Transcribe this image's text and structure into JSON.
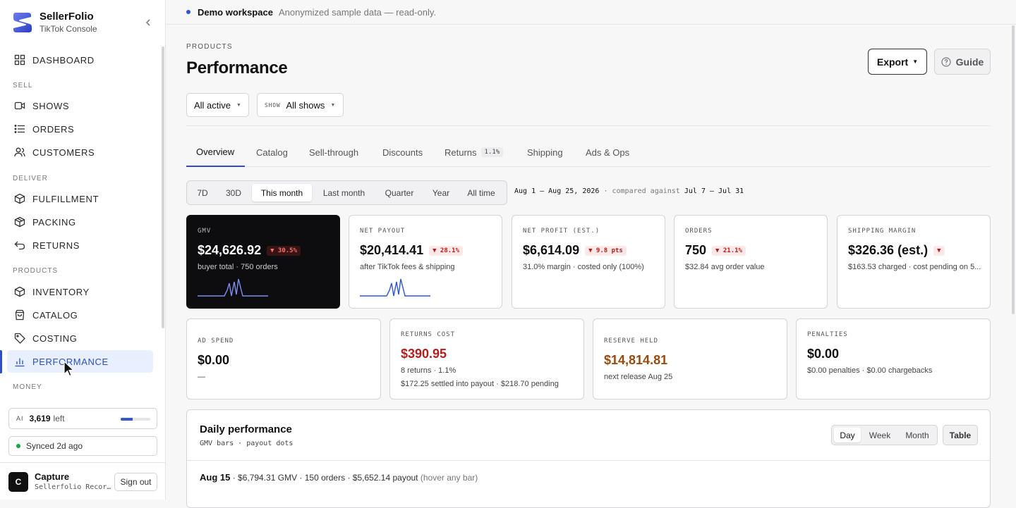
{
  "brand": {
    "name": "SellerFolio",
    "sub": "TikTok Console"
  },
  "nav": {
    "dashboard": "DASHBOARD",
    "sections": {
      "sell": "SELL",
      "deliver": "DELIVER",
      "products": "PRODUCTS",
      "money": "MONEY"
    },
    "shows": "SHOWS",
    "orders": "ORDERS",
    "customers": "CUSTOMERS",
    "fulfillment": "FULFILLMENT",
    "packing": "PACKING",
    "returns": "RETURNS",
    "inventory": "INVENTORY",
    "catalog": "CATALOG",
    "costing": "COSTING",
    "performance": "PERFORMANCE"
  },
  "ai": {
    "label": "AI",
    "count": "3,619",
    "left": "left",
    "usage_fraction": 0.4
  },
  "sync": {
    "text": "Synced 2d ago"
  },
  "user": {
    "initial": "C",
    "name": "Capture",
    "sub": "Sellerfolio Recor…",
    "signout": "Sign out"
  },
  "banner": {
    "title": "Demo workspace",
    "sub": "Anonymized sample data — read-only."
  },
  "page": {
    "eyebrow": "PRODUCTS",
    "title": "Performance",
    "export": "Export",
    "guide": "Guide"
  },
  "filters": {
    "status": "All active",
    "show_label": "SHOW",
    "show_value": "All shows"
  },
  "tabs": {
    "overview": "Overview",
    "catalog": "Catalog",
    "sellthrough": "Sell-through",
    "discounts": "Discounts",
    "returns": "Returns",
    "returns_badge": "1.1%",
    "shipping": "Shipping",
    "adsops": "Ads & Ops"
  },
  "range": {
    "options": {
      "d7": "7D",
      "d30": "30D",
      "this_month": "This month",
      "last_month": "Last month",
      "quarter": "Quarter",
      "year": "Year",
      "all": "All time"
    },
    "current": "Aug 1 – Aug 25, 2026",
    "compared_label": "· compared against",
    "compared": "Jul 7 – Jul 31"
  },
  "kpis": {
    "gmv": {
      "label": "GMV",
      "value": "$24,626.92",
      "delta": "▼ 30.5%",
      "sub": "buyer total · 750 orders"
    },
    "payout": {
      "label": "NET PAYOUT",
      "value": "$20,414.41",
      "delta": "▼ 28.1%",
      "sub": "after TikTok fees & shipping"
    },
    "profit": {
      "label": "NET PROFIT (EST.)",
      "value": "$6,614.09",
      "delta": "▼ 9.8 pts",
      "sub": "31.0% margin · costed only (100%)"
    },
    "orders": {
      "label": "ORDERS",
      "value": "750",
      "delta": "▼ 21.1%",
      "sub": "$32.84 avg order value"
    },
    "shipping": {
      "label": "SHIPPING MARGIN",
      "value": "$326.36 (est.)",
      "delta": "▼",
      "sub": "$163.53 charged · cost pending on 5..."
    }
  },
  "kpis2": {
    "ads": {
      "label": "AD SPEND",
      "value": "$0.00",
      "sub": "—"
    },
    "returns": {
      "label": "RETURNS COST",
      "value": "$390.95",
      "sub": "8 returns · 1.1%",
      "sub2": "$172.25 settled into payout · $218.70 pending"
    },
    "reserve": {
      "label": "RESERVE HELD",
      "value": "$14,814.81",
      "sub": "next release Aug 25"
    },
    "penalties": {
      "label": "PENALTIES",
      "value": "$0.00",
      "sub": "$0.00 penalties · $0.00 chargebacks"
    }
  },
  "daily": {
    "title": "Daily performance",
    "sub": "GMV bars · payout dots",
    "seg": {
      "day": "Day",
      "week": "Week",
      "month": "Month"
    },
    "table": "Table",
    "date": "Aug 15",
    "summary": "· $6,794.31 GMV · 150 orders · $5,652.14 payout",
    "hint": "(hover any bar)"
  },
  "colors": {
    "accent": "#2b4ec7",
    "negative": "#b91c1c",
    "reserve": "#9a4a0d"
  }
}
